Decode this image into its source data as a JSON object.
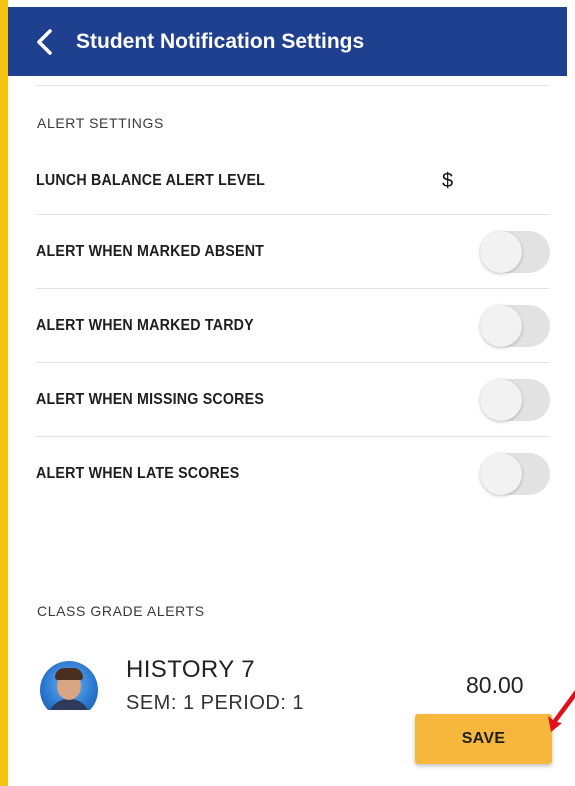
{
  "header": {
    "title": "Student Notification Settings",
    "back_icon": "chevron-left-icon"
  },
  "alert_settings": {
    "section_label": "ALERT SETTINGS",
    "lunch_balance": {
      "label": "LUNCH BALANCE ALERT LEVEL",
      "currency_symbol": "$",
      "value": ""
    },
    "toggles": [
      {
        "label": "ALERT WHEN MARKED ABSENT",
        "on": false
      },
      {
        "label": "ALERT WHEN MARKED TARDY",
        "on": false
      },
      {
        "label": "ALERT WHEN MISSING SCORES",
        "on": false
      },
      {
        "label": "ALERT WHEN LATE SCORES",
        "on": false
      }
    ]
  },
  "class_grade_alerts": {
    "section_label": "CLASS GRADE ALERTS",
    "classes": [
      {
        "name": "HISTORY 7",
        "subtitle": "SEM: 1  PERIOD: 1",
        "grade": "80.00"
      }
    ]
  },
  "footer": {
    "save_label": "SAVE"
  },
  "colors": {
    "header_bg": "#1f3f8f",
    "save_bg": "#f7b73c",
    "frame_accent": "#f5c211",
    "annotation_arrow": "#e0101a"
  }
}
